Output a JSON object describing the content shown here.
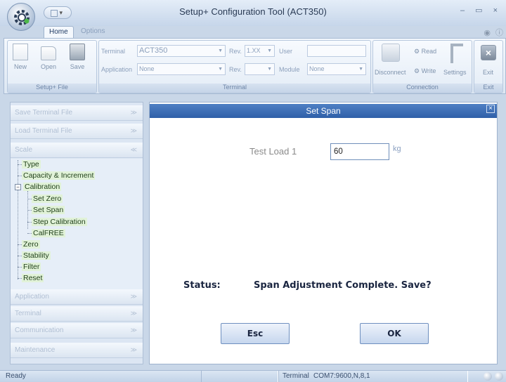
{
  "window": {
    "title": "Setup+ Configuration Tool (ACT350)",
    "controls": "– ▭ ×"
  },
  "qat": {
    "glyph": "▾"
  },
  "tabs": [
    {
      "label": "Home"
    },
    {
      "label": "Options"
    }
  ],
  "tab_icons": "◉ ⓘ",
  "ribbon": {
    "file_group": {
      "label": "Setup+ File",
      "new_label": "New",
      "open_label": "Open",
      "save_label": "Save"
    },
    "terminal_group": {
      "label": "Terminal",
      "terminal_label": "Terminal",
      "terminal_value": "ACT350",
      "rev1_label": "Rev.",
      "rev1_value": "1.XX",
      "user_label": "User",
      "user_value": "",
      "application_label": "Application",
      "application_value": "None",
      "rev2_label": "Rev.",
      "rev2_value": "",
      "module_label": "Module",
      "module_value": "None"
    },
    "connection_group": {
      "label": "Connection",
      "disconnect_label": "Disconnect",
      "read_label": "Read",
      "write_label": "Write",
      "settings_label": "Settings"
    },
    "exit_group": {
      "label": "Exit",
      "exit_label": "Exit"
    }
  },
  "sidebar": {
    "sections_top": [
      {
        "label": "Save Terminal File"
      },
      {
        "label": "Load Terminal File"
      },
      {
        "label": "Scale"
      }
    ],
    "tree": {
      "type": "Type",
      "capacity": "Capacity & Increment",
      "calibration": "Calibration",
      "set_zero": "Set Zero",
      "set_span": "Set Span",
      "step_calibration": "Step Calibration",
      "calfree": "CalFREE",
      "zero": "Zero",
      "stability": "Stability",
      "filter": "Filter",
      "reset": "Reset"
    },
    "sections_bottom": [
      {
        "label": "Application"
      },
      {
        "label": "Terminal"
      },
      {
        "label": "Communication"
      },
      {
        "label": "Maintenance"
      }
    ]
  },
  "panel": {
    "title": "Set Span",
    "close_glyph": "×",
    "test_load_label": "Test Load 1",
    "test_load_value": "60",
    "unit": "kg",
    "status_label": "Status:",
    "status_text": "Span Adjustment Complete. Save?",
    "esc_label": "Esc",
    "ok_label": "OK"
  },
  "statusbar": {
    "ready": "Ready",
    "terminal_label": "Terminal",
    "port": "COM7:9600,N,8,1"
  }
}
